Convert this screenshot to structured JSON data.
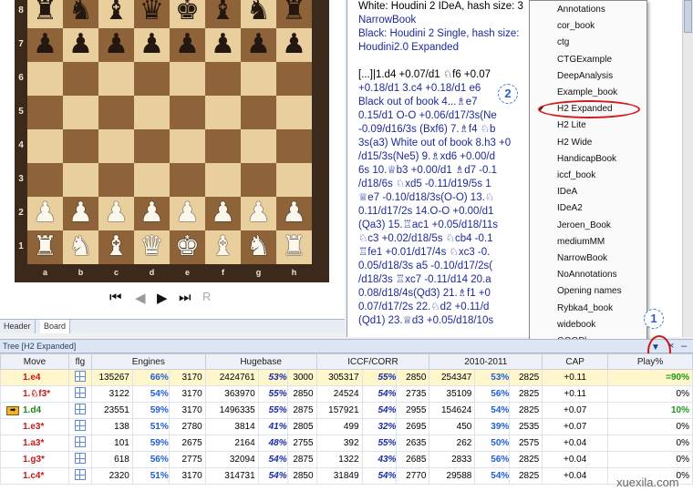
{
  "board": {
    "ranks": [
      "8",
      "7",
      "6",
      "5",
      "4",
      "3",
      "2",
      "1"
    ],
    "files": [
      "a",
      "b",
      "c",
      "d",
      "e",
      "f",
      "g",
      "h"
    ],
    "rows": [
      [
        "r",
        "n",
        "b",
        "q",
        "k",
        "b",
        "n",
        "r"
      ],
      [
        "p",
        "p",
        "p",
        "p",
        "p",
        "p",
        "p",
        "p"
      ],
      [
        "",
        "",
        "",
        "",
        "",
        "",
        "",
        ""
      ],
      [
        "",
        "",
        "",
        "",
        "",
        "",
        "",
        ""
      ],
      [
        "",
        "",
        "",
        "",
        "",
        "",
        "",
        ""
      ],
      [
        "",
        "",
        "",
        "",
        "",
        "",
        "",
        ""
      ],
      [
        "P",
        "P",
        "P",
        "P",
        "P",
        "P",
        "P",
        "P"
      ],
      [
        "R",
        "N",
        "B",
        "Q",
        "K",
        "B",
        "N",
        "R"
      ]
    ]
  },
  "nav": {
    "first": "⏮",
    "prev": "◀",
    "next": "▶",
    "last": "⏭",
    "extra": "R"
  },
  "tabs": [
    "Header",
    "Board"
  ],
  "notation": [
    {
      "t": "White: Houdini 2 IDeA, hash size: 3",
      "c": "b"
    },
    {
      "t": "NarrowBook",
      "c": ""
    },
    {
      "t": "Black: Houdini 2 Single, hash size:",
      "c": ""
    },
    {
      "t": "Houdini2.0 Expanded",
      "c": ""
    },
    {
      "t": "",
      "c": ""
    },
    {
      "t": "[...]|1.d4 +0.07/d1 ♘f6 +0.07",
      "c": "b"
    },
    {
      "t": "+0.18/d1 3.c4 +0.18/d1 e6",
      "c": ""
    },
    {
      "t": "Black out of book 4...♗e7",
      "c": ""
    },
    {
      "t": "0.15/d1 O-O +0.06/d17/3s(Ne",
      "c": ""
    },
    {
      "t": "-0.09/d16/3s (Bxf6) 7.♗f4 ♘b",
      "c": ""
    },
    {
      "t": "3s(a3) White out of book 8.h3 +0",
      "c": ""
    },
    {
      "t": "/d15/3s(Ne5) 9.♗xd6 +0.00/d",
      "c": ""
    },
    {
      "t": "6s 10.♕b3 +0.00/d1 ♗d7 -0.1",
      "c": ""
    },
    {
      "t": "/d18/6s ♘xd5 -0.11/d19/5s 1",
      "c": ""
    },
    {
      "t": "♕e7 -0.10/d18/3s(O-O) 13.♘",
      "c": ""
    },
    {
      "t": "0.11/d17/2s 14.O-O +0.00/d1",
      "c": ""
    },
    {
      "t": "(Qa3) 15.♖ac1 +0.05/d18/11s",
      "c": ""
    },
    {
      "t": "♘c3 +0.02/d18/5s ♘cb4 -0.1",
      "c": ""
    },
    {
      "t": "♖fe1 +0.01/d17/4s ♘xc3 -0.",
      "c": ""
    },
    {
      "t": "0.05/d18/3s a5 -0.10/d17/2s(",
      "c": ""
    },
    {
      "t": "/d18/3s ♖xc7 -0.11/d14 20.a",
      "c": ""
    },
    {
      "t": "0.08/d18/4s(Qd3) 21.♗f1 +0",
      "c": ""
    },
    {
      "t": "0.07/d17/2s 22.♘d2 +0.11/d",
      "c": ""
    },
    {
      "t": "(Qd1) 23.♕d3 +0.05/d18/10s",
      "c": ""
    }
  ],
  "book_menu": {
    "items": [
      "Annotations",
      "cor_book",
      "ctg",
      "CTGExample",
      "DeepAnalysis",
      "Example_book",
      "H2 Expanded",
      "H2 Lite",
      "H2 Wide",
      "HandicapBook",
      "iccf_book",
      "IDeA",
      "IDeA2",
      "Jeroen_Book",
      "mediumMM",
      "NarrowBook",
      "NoAnnotations",
      "Opening names",
      "Rybka4_book",
      "widebook",
      "GOOD\\"
    ],
    "checked": "H2 Expanded",
    "check_mark": "✔"
  },
  "callouts": {
    "one": "1",
    "two": "2"
  },
  "tree": {
    "title": "Tree [H2 Expanded]",
    "controls": {
      "dropdown": "▼",
      "close": "×",
      "minimize": "–"
    },
    "header_top": [
      "Move",
      "flg",
      "Engines",
      "Hugebase",
      "ICCF/CORR",
      "2010-2011",
      "CAP",
      "Play%"
    ],
    "rows": [
      {
        "move": "1.e4",
        "flag": "",
        "eng_n": "135267",
        "eng_p": "66%",
        "eng_e": "3170",
        "hb_n": "2424761",
        "hb_p": "53%",
        "hb_e": "3000",
        "ic_n": "305317",
        "ic_p": "55%",
        "ic_e": "2850",
        "y_n": "254347",
        "y_p": "53%",
        "y_e": "2825",
        "cap": "+0.11",
        "play": "=90%",
        "hl": true
      },
      {
        "move": "1.♘f3*",
        "flag": "",
        "eng_n": "3122",
        "eng_p": "54%",
        "eng_e": "3170",
        "hb_n": "363970",
        "hb_p": "55%",
        "hb_e": "2850",
        "ic_n": "24524",
        "ic_p": "54%",
        "ic_e": "2735",
        "y_n": "35109",
        "y_p": "56%",
        "y_e": "2825",
        "cap": "+0.11",
        "play": "0%"
      },
      {
        "move": "1.d4",
        "flag": "➡",
        "eng_n": "23551",
        "eng_p": "59%",
        "eng_e": "3170",
        "hb_n": "1496335",
        "hb_p": "55%",
        "hb_e": "2875",
        "ic_n": "157921",
        "ic_p": "54%",
        "ic_e": "2955",
        "y_n": "154624",
        "y_p": "54%",
        "y_e": "2825",
        "cap": "+0.07",
        "play": "10%",
        "green": true
      },
      {
        "move": "1.e3*",
        "flag": "",
        "eng_n": "138",
        "eng_p": "51%",
        "eng_e": "2780",
        "hb_n": "3814",
        "hb_p": "41%",
        "hb_e": "2805",
        "ic_n": "499",
        "ic_p": "32%",
        "ic_e": "2695",
        "y_n": "450",
        "y_p": "39%",
        "y_e": "2535",
        "cap": "+0.07",
        "play": "0%"
      },
      {
        "move": "1.a3*",
        "flag": "",
        "eng_n": "101",
        "eng_p": "59%",
        "eng_e": "2675",
        "hb_n": "2164",
        "hb_p": "48%",
        "hb_e": "2755",
        "ic_n": "392",
        "ic_p": "55%",
        "ic_e": "2635",
        "y_n": "262",
        "y_p": "50%",
        "y_e": "2575",
        "cap": "+0.04",
        "play": "0%"
      },
      {
        "move": "1.g3*",
        "flag": "",
        "eng_n": "618",
        "eng_p": "56%",
        "eng_e": "2775",
        "hb_n": "32094",
        "hb_p": "54%",
        "hb_e": "2875",
        "ic_n": "1322",
        "ic_p": "43%",
        "ic_e": "2685",
        "y_n": "2833",
        "y_p": "56%",
        "y_e": "2825",
        "cap": "+0.04",
        "play": "0%"
      },
      {
        "move": "1.c4*",
        "flag": "",
        "eng_n": "2320",
        "eng_p": "51%",
        "eng_e": "3170",
        "hb_n": "314731",
        "hb_p": "54%",
        "hb_e": "2850",
        "ic_n": "31849",
        "ic_p": "54%",
        "ic_e": "2770",
        "y_n": "29588",
        "y_p": "54%",
        "y_e": "2825",
        "cap": "+0.04",
        "play": "0%"
      }
    ]
  },
  "watermark": "xuexila.com"
}
